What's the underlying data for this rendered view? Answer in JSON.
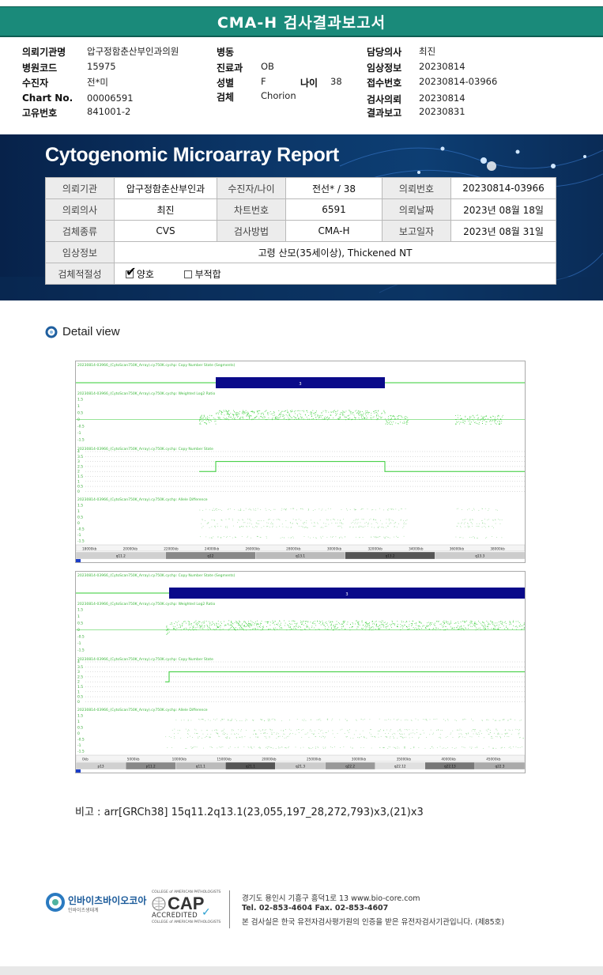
{
  "report": {
    "title": "CMA-H 검사결과보고서"
  },
  "patient_info": {
    "col1": [
      {
        "label": "의뢰기관명",
        "value": "압구정함춘산부인과의원"
      },
      {
        "label": "병원코드",
        "value": "15975"
      },
      {
        "label": "수진자",
        "value": "전*미"
      },
      {
        "label": "Chart No.",
        "value": "00006591"
      },
      {
        "label": "고유번호",
        "value": "841001-2"
      }
    ],
    "col2": [
      {
        "label": "병동",
        "value": ""
      },
      {
        "label": "진료과",
        "value": "OB"
      },
      {
        "label": "성별",
        "value": "F"
      },
      {
        "label": "검체",
        "value": "Chorion"
      }
    ],
    "age_label": "나이",
    "age_value": "38",
    "col3": [
      {
        "label": "담당의사",
        "value": "최진"
      },
      {
        "label": "임상정보",
        "value": "20230814"
      },
      {
        "label": "접수번호",
        "value": "20230814-03966"
      },
      {
        "label": "검사의뢰",
        "value": "20230814"
      },
      {
        "label": "결과보고",
        "value": "20230831"
      }
    ]
  },
  "banner": {
    "title": "Cytogenomic Microarray Report",
    "rows": [
      [
        "의뢰기관",
        "압구정함춘산부인과",
        "수진자/나이",
        "전선* / 38",
        "의뢰번호",
        "20230814-03966"
      ],
      [
        "의뢰의사",
        "최진",
        "차트번호",
        "6591",
        "의뢰날짜",
        "2023년 08월 18일"
      ],
      [
        "검체종류",
        "CVS",
        "검사방법",
        "CMA-H",
        "보고일자",
        "2023년 08월 31일"
      ]
    ],
    "clinical_label": "임상정보",
    "clinical_value": "고령 산모(35세이상), Thickened NT",
    "suitability_label": "검체적절성",
    "opt_good": "양호",
    "opt_bad": "부적합"
  },
  "detail": {
    "title": "Detail view"
  },
  "plots": [
    {
      "tracks": [
        "20230814-03966_(CytoScan750K_Array).cy750K.cychp: Copy Number State (Segments)",
        "20230814-03966_(CytoScan750K_Array).cy750K.cychp: Weighted Log2 Ratio",
        "20230814-03966_(CytoScan750K_Array).cy750K.cychp: Copy Number State",
        "20230814-03966_(CytoScan750K_Array).cy750K.cychp: Allele Difference"
      ],
      "segment_label": "3",
      "axis": [
        "18000kb",
        "20000kb",
        "22000kb",
        "24000kb",
        "26000kb",
        "28000kb",
        "30000kb",
        "32000kb",
        "34000kb",
        "36000kb",
        "38000kb"
      ],
      "bands": [
        "q11.2",
        "q12",
        "q13.1",
        "q13.2",
        "q13.3"
      ]
    },
    {
      "tracks": [
        "20230814-03966_(CytoScan750K_Array).cy750K.cychp: Copy Number State (Segments)",
        "20230814-03966_(CytoScan750K_Array).cy750K.cychp: Weighted Log2 Ratio",
        "20230814-03966_(CytoScan750K_Array).cy750K.cychp: Copy Number State",
        "20230814-03966_(CytoScan750K_Array).cy750K.cychp: Allele Difference"
      ],
      "segment_label": "3",
      "axis": [
        "0kb",
        "5000kb",
        "10000kb",
        "15000kb",
        "20000kb",
        "25000kb",
        "30000kb",
        "35000kb",
        "40000kb",
        "45000kb"
      ],
      "bands": [
        "p13",
        "p11.2",
        "q11.1",
        "q21.1",
        "q21.3",
        "q22.2",
        "q22.12",
        "q22.13",
        "q22.3"
      ]
    }
  ],
  "remark": {
    "text": "비고 : arr[GRCh38] 15q11.2q13.1(23,055,197_28,272,793)x3,(21)x3"
  },
  "footer": {
    "company": "인바이츠바이오코아",
    "company_sub": "인바이츠생태계",
    "cap_top": "COLLEGE of AMERICAN PATHOLOGISTS",
    "cap": "CAP",
    "cap_acc": "ACCREDITED",
    "cap_bottom": "COLLEGE of AMERICAN PATHOLOGISTS",
    "address": "경기도 용인시 기흥구 흥덕1로 13   www.bio-core.com",
    "tel": "Tel. 02-853-4604   Fax. 02-853-4607",
    "note": "본 검사실은 한국 유전자검사평가원의 인증을 받은 유전자검사기관입니다. (제85호)"
  }
}
